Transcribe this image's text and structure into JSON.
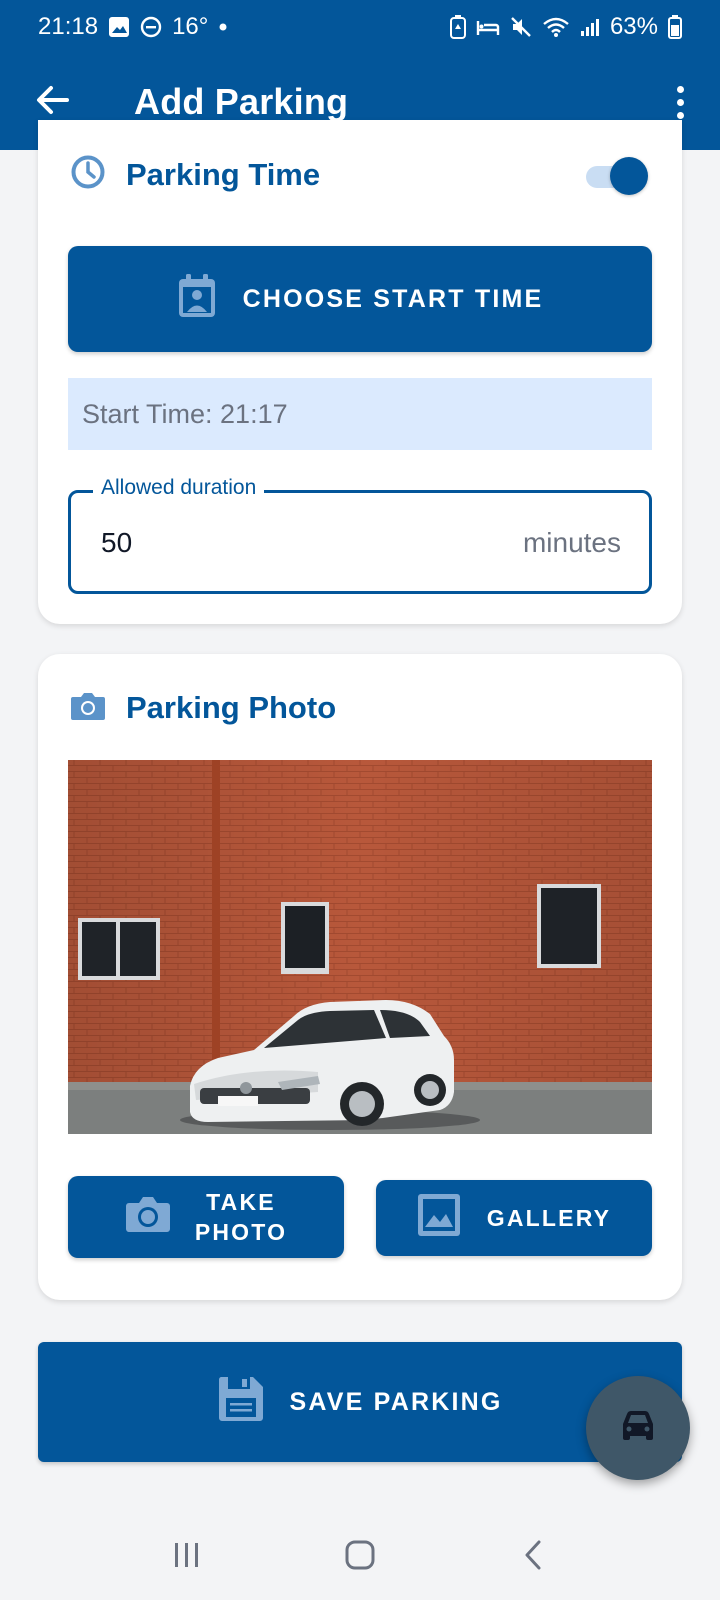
{
  "status_bar": {
    "time": "21:18",
    "temperature": "16°",
    "battery": "63%",
    "icons": [
      "gallery-icon",
      "do-not-disturb-icon",
      "dot-icon",
      "battery-saver-icon",
      "bed-icon",
      "mute-icon",
      "wifi-icon",
      "signal-icon",
      "battery-icon"
    ]
  },
  "app_bar": {
    "title": "Add Parking",
    "back_icon": "arrow-left-icon",
    "menu_icon": "more-vert-icon"
  },
  "parking_time": {
    "title": "Parking Time",
    "icon": "clock-icon",
    "toggle_on": true,
    "choose_start_label": "CHOOSE START TIME",
    "start_time_text": "Start Time: 21:17",
    "duration_label": "Allowed duration",
    "duration_value": "50",
    "duration_unit": "minutes"
  },
  "parking_photo": {
    "title": "Parking Photo",
    "icon": "camera-icon",
    "take_photo_label_1": "TAKE",
    "take_photo_label_2": "PHOTO",
    "gallery_label": "GALLERY"
  },
  "save_label": "SAVE PARKING",
  "fab_icon": "car-icon",
  "nav_bar": [
    "recents-icon",
    "home-icon",
    "back-icon"
  ],
  "colors": {
    "primary": "#03569a",
    "primary_light": "#dbeafe",
    "fab": "#3f5768"
  }
}
